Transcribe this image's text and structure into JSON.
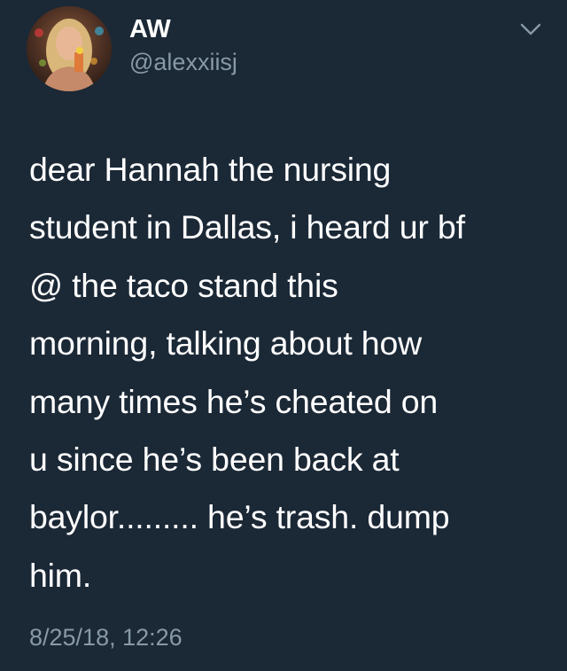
{
  "tweet": {
    "author": {
      "display_name": "AW",
      "handle": "@alexxiisj",
      "avatar_icon": "profile-photo"
    },
    "menu_icon": "chevron-down-icon",
    "text_lines": [
      "dear Hannah the nursing",
      "student in Dallas, i heard ur bf",
      "@ the taco stand this",
      "morning, talking about how",
      "many times he’s cheated on",
      "u since he’s been back at",
      "baylor......... he’s trash. dump",
      "him."
    ],
    "timestamp": "8/25/18, 12:26"
  },
  "colors": {
    "background": "#1b2836",
    "primary_text": "#ffffff",
    "secondary_text": "#8899a6"
  }
}
